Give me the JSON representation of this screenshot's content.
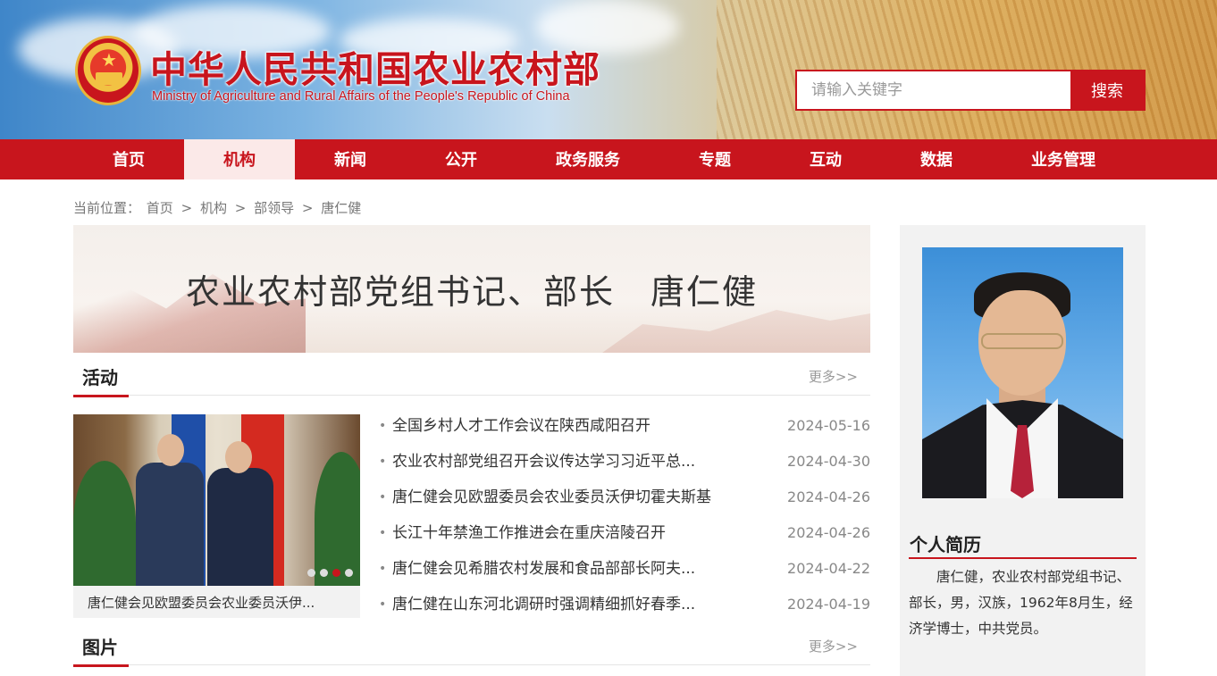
{
  "header": {
    "title": "中华人民共和国农业农村部",
    "subtitle": "Ministry of Agriculture and Rural Affairs of the People's Republic of China",
    "search_placeholder": "请输入关键字",
    "search_button": "搜索"
  },
  "nav": {
    "items": [
      {
        "label": "首页",
        "active": false
      },
      {
        "label": "机构",
        "active": true
      },
      {
        "label": "新闻",
        "active": false
      },
      {
        "label": "公开",
        "active": false
      },
      {
        "label": "政务服务",
        "active": false
      },
      {
        "label": "专题",
        "active": false
      },
      {
        "label": "互动",
        "active": false
      },
      {
        "label": "数据",
        "active": false
      },
      {
        "label": "业务管理",
        "active": false
      }
    ]
  },
  "breadcrumb": {
    "prefix": "当前位置：",
    "items": [
      "首页",
      "机构",
      "部领导",
      "唐仁健"
    ],
    "separator": ">"
  },
  "leader": {
    "banner_title": "农业农村部党组书记、部长　唐仁健"
  },
  "activities": {
    "title": "活动",
    "more": "更多>>",
    "photo_caption": "唐仁健会见欧盟委员会农业委员沃伊...",
    "carousel": {
      "count": 4,
      "active_index": 2
    },
    "news": [
      {
        "title": "全国乡村人才工作会议在陕西咸阳召开",
        "date": "2024-05-16"
      },
      {
        "title": "农业农村部党组召开会议传达学习习近平总...",
        "date": "2024-04-30"
      },
      {
        "title": "唐仁健会见欧盟委员会农业委员沃伊切霍夫斯基",
        "date": "2024-04-26"
      },
      {
        "title": "长江十年禁渔工作推进会在重庆涪陵召开",
        "date": "2024-04-26"
      },
      {
        "title": "唐仁健会见希腊农村发展和食品部部长阿夫...",
        "date": "2024-04-22"
      },
      {
        "title": "唐仁健在山东河北调研时强调精细抓好春季...",
        "date": "2024-04-19"
      }
    ]
  },
  "pictures": {
    "title": "图片",
    "more": "更多>>"
  },
  "sidebar": {
    "bio_title": "个人简历",
    "bio_text": "唐仁健，农业农村部党组书记、部长，男，汉族，1962年8月生，经济学博士，中共党员。"
  },
  "colors": {
    "brand_red": "#c8151d",
    "nav_active_bg": "#fbe9e8"
  }
}
